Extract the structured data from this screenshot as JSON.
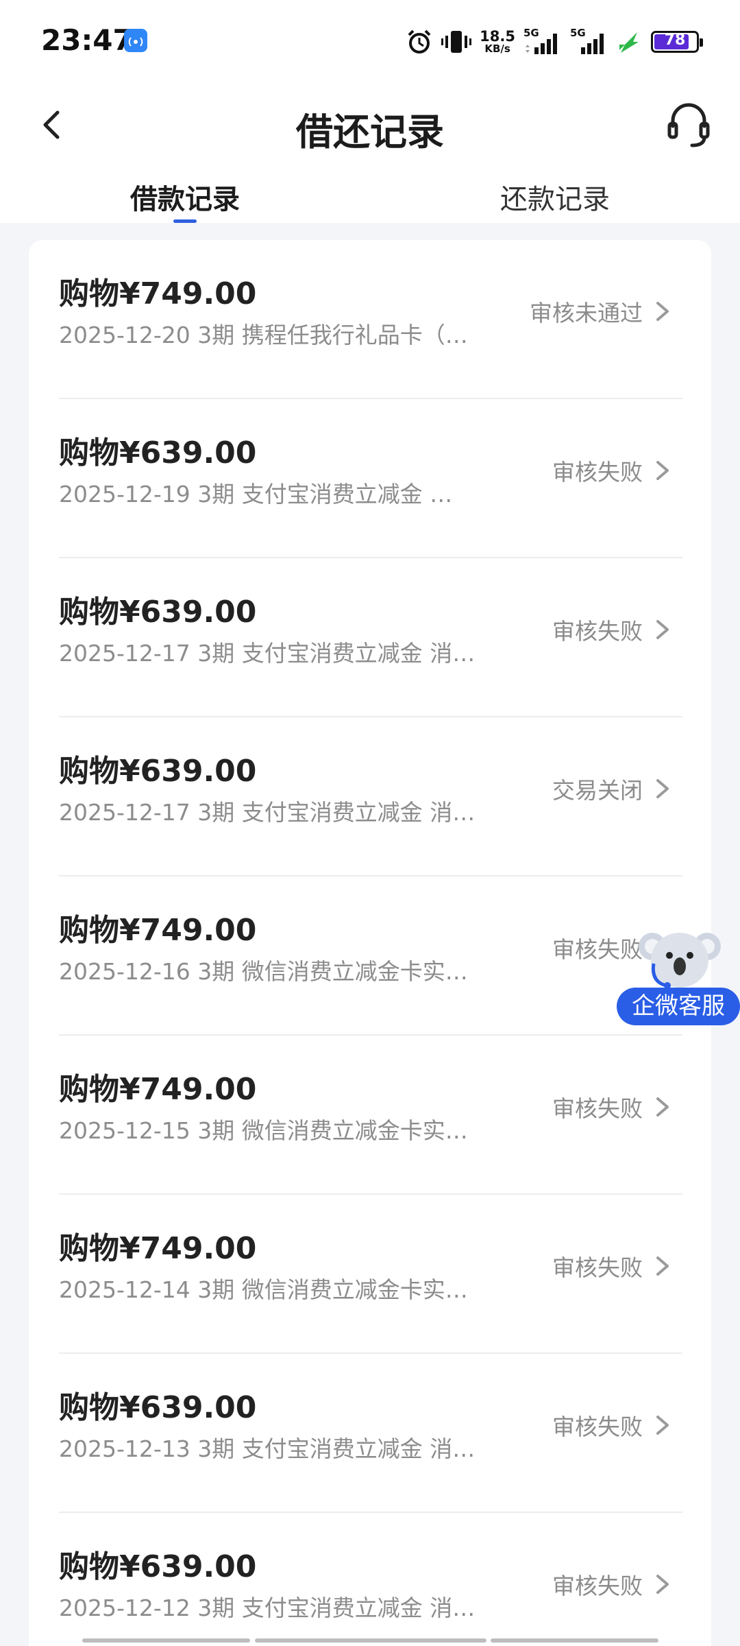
{
  "status_bar": {
    "time": "23:47",
    "net_speed_value": "18.5",
    "net_speed_unit": "KB/s",
    "sim1_label": "5G",
    "sim2_label": "5G",
    "battery_level": "78",
    "battery_color": "#5a2bd6"
  },
  "header": {
    "title": "借还记录",
    "tabs": [
      {
        "label": "借款记录",
        "active": true
      },
      {
        "label": "还款记录",
        "active": false
      }
    ]
  },
  "records": [
    {
      "title": "购物¥749.00",
      "subtitle": "2025-12-20 3期  携程任我行礼品卡（…",
      "status": "审核未通过"
    },
    {
      "title": "购物¥639.00",
      "subtitle": "2025-12-19 3期  支付宝消费立减金 …",
      "status": "审核失败"
    },
    {
      "title": "购物¥639.00",
      "subtitle": "2025-12-17 3期  支付宝消费立减金 消…",
      "status": "审核失败"
    },
    {
      "title": "购物¥639.00",
      "subtitle": "2025-12-17 3期  支付宝消费立减金 消…",
      "status": "交易关闭"
    },
    {
      "title": "购物¥749.00",
      "subtitle": "2025-12-16 3期  微信消费立减金卡实…",
      "status": "审核失败"
    },
    {
      "title": "购物¥749.00",
      "subtitle": "2025-12-15 3期  微信消费立减金卡实…",
      "status": "审核失败"
    },
    {
      "title": "购物¥749.00",
      "subtitle": "2025-12-14 3期  微信消费立减金卡实…",
      "status": "审核失败"
    },
    {
      "title": "购物¥639.00",
      "subtitle": "2025-12-13 3期  支付宝消费立减金 消…",
      "status": "审核失败"
    },
    {
      "title": "购物¥639.00",
      "subtitle": "2025-12-12 3期  支付宝消费立减金 消…",
      "status": "审核失败"
    }
  ],
  "floating_service": {
    "label": "企微客服"
  },
  "colors": {
    "accent": "#2f5fe0",
    "float_button": "#2a5ee6",
    "muted_text": "#8c8c8c"
  }
}
